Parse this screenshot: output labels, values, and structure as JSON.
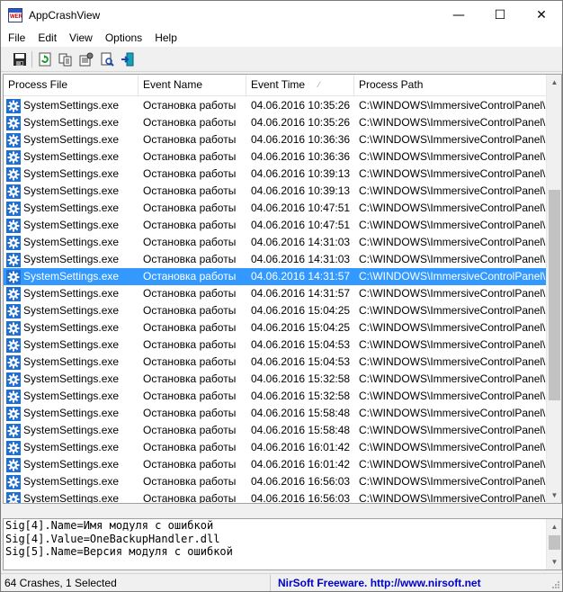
{
  "window": {
    "title": "AppCrashView",
    "icon_label": "WER",
    "minimize_glyph": "—",
    "maximize_glyph": "☐",
    "close_glyph": "✕"
  },
  "menu": [
    "File",
    "Edit",
    "View",
    "Options",
    "Help"
  ],
  "toolbar": [
    "save-icon",
    "refresh-icon",
    "copy-icon",
    "properties-icon",
    "report-icon",
    "exit-icon"
  ],
  "list": {
    "columns": [
      "Process File",
      "Event Name",
      "Event Time",
      "Process Path"
    ],
    "sort_indicator": "⁄",
    "rows": [
      {
        "file": "SystemSettings.exe",
        "event": "Остановка работы",
        "time": "04.06.2016 10:35:26",
        "path": "C:\\WINDOWS\\ImmersiveControlPanel\\S"
      },
      {
        "file": "SystemSettings.exe",
        "event": "Остановка работы",
        "time": "04.06.2016 10:35:26",
        "path": "C:\\WINDOWS\\ImmersiveControlPanel\\S"
      },
      {
        "file": "SystemSettings.exe",
        "event": "Остановка работы",
        "time": "04.06.2016 10:36:36",
        "path": "C:\\WINDOWS\\ImmersiveControlPanel\\S"
      },
      {
        "file": "SystemSettings.exe",
        "event": "Остановка работы",
        "time": "04.06.2016 10:36:36",
        "path": "C:\\WINDOWS\\ImmersiveControlPanel\\S"
      },
      {
        "file": "SystemSettings.exe",
        "event": "Остановка работы",
        "time": "04.06.2016 10:39:13",
        "path": "C:\\WINDOWS\\ImmersiveControlPanel\\S"
      },
      {
        "file": "SystemSettings.exe",
        "event": "Остановка работы",
        "time": "04.06.2016 10:39:13",
        "path": "C:\\WINDOWS\\ImmersiveControlPanel\\S"
      },
      {
        "file": "SystemSettings.exe",
        "event": "Остановка работы",
        "time": "04.06.2016 10:47:51",
        "path": "C:\\WINDOWS\\ImmersiveControlPanel\\S"
      },
      {
        "file": "SystemSettings.exe",
        "event": "Остановка работы",
        "time": "04.06.2016 10:47:51",
        "path": "C:\\WINDOWS\\ImmersiveControlPanel\\S"
      },
      {
        "file": "SystemSettings.exe",
        "event": "Остановка работы",
        "time": "04.06.2016 14:31:03",
        "path": "C:\\WINDOWS\\ImmersiveControlPanel\\S"
      },
      {
        "file": "SystemSettings.exe",
        "event": "Остановка работы",
        "time": "04.06.2016 14:31:03",
        "path": "C:\\WINDOWS\\ImmersiveControlPanel\\S"
      },
      {
        "file": "SystemSettings.exe",
        "event": "Остановка работы",
        "time": "04.06.2016 14:31:57",
        "path": "C:\\WINDOWS\\ImmersiveControlPanel\\S",
        "selected": true
      },
      {
        "file": "SystemSettings.exe",
        "event": "Остановка работы",
        "time": "04.06.2016 14:31:57",
        "path": "C:\\WINDOWS\\ImmersiveControlPanel\\S"
      },
      {
        "file": "SystemSettings.exe",
        "event": "Остановка работы",
        "time": "04.06.2016 15:04:25",
        "path": "C:\\WINDOWS\\ImmersiveControlPanel\\S"
      },
      {
        "file": "SystemSettings.exe",
        "event": "Остановка работы",
        "time": "04.06.2016 15:04:25",
        "path": "C:\\WINDOWS\\ImmersiveControlPanel\\S"
      },
      {
        "file": "SystemSettings.exe",
        "event": "Остановка работы",
        "time": "04.06.2016 15:04:53",
        "path": "C:\\WINDOWS\\ImmersiveControlPanel\\S"
      },
      {
        "file": "SystemSettings.exe",
        "event": "Остановка работы",
        "time": "04.06.2016 15:04:53",
        "path": "C:\\WINDOWS\\ImmersiveControlPanel\\S"
      },
      {
        "file": "SystemSettings.exe",
        "event": "Остановка работы",
        "time": "04.06.2016 15:32:58",
        "path": "C:\\WINDOWS\\ImmersiveControlPanel\\S"
      },
      {
        "file": "SystemSettings.exe",
        "event": "Остановка работы",
        "time": "04.06.2016 15:32:58",
        "path": "C:\\WINDOWS\\ImmersiveControlPanel\\S"
      },
      {
        "file": "SystemSettings.exe",
        "event": "Остановка работы",
        "time": "04.06.2016 15:58:48",
        "path": "C:\\WINDOWS\\ImmersiveControlPanel\\S"
      },
      {
        "file": "SystemSettings.exe",
        "event": "Остановка работы",
        "time": "04.06.2016 15:58:48",
        "path": "C:\\WINDOWS\\ImmersiveControlPanel\\S"
      },
      {
        "file": "SystemSettings.exe",
        "event": "Остановка работы",
        "time": "04.06.2016 16:01:42",
        "path": "C:\\WINDOWS\\ImmersiveControlPanel\\S"
      },
      {
        "file": "SystemSettings.exe",
        "event": "Остановка работы",
        "time": "04.06.2016 16:01:42",
        "path": "C:\\WINDOWS\\ImmersiveControlPanel\\S"
      },
      {
        "file": "SystemSettings.exe",
        "event": "Остановка работы",
        "time": "04.06.2016 16:56:03",
        "path": "C:\\WINDOWS\\ImmersiveControlPanel\\S"
      },
      {
        "file": "SystemSettings.exe",
        "event": "Остановка работы",
        "time": "04.06.2016 16:56:03",
        "path": "C:\\WINDOWS\\ImmersiveControlPanel\\S"
      }
    ]
  },
  "details": [
    "Sig[4].Name=Имя модуля с ошибкой",
    "Sig[4].Value=OneBackupHandler.dll",
    "Sig[5].Name=Версия модуля с ошибкой"
  ],
  "status": {
    "summary": "64 Crashes, 1 Selected",
    "link": "NirSoft Freeware.  http://www.nirsoft.net"
  },
  "colors": {
    "selection": "#3399ff",
    "gear_icon": "#1f6fd1",
    "link": "#0000c8"
  }
}
